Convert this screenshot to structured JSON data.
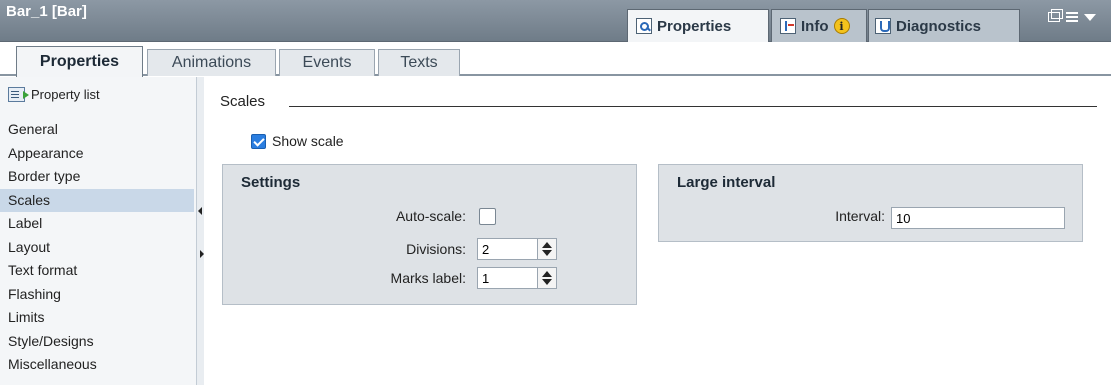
{
  "window": {
    "title": "Bar_1 [Bar]"
  },
  "inspector_tabs": [
    {
      "label": "Properties",
      "icon": "properties-icon",
      "active": true
    },
    {
      "label": "Info",
      "icon": "info-icon",
      "badge": "i"
    },
    {
      "label": "Diagnostics",
      "icon": "diagnostics-icon"
    }
  ],
  "sub_tabs": [
    {
      "label": "Properties",
      "active": true
    },
    {
      "label": "Animations"
    },
    {
      "label": "Events"
    },
    {
      "label": "Texts"
    }
  ],
  "sidebar": {
    "header": "Property list",
    "items": [
      {
        "label": "General"
      },
      {
        "label": "Appearance"
      },
      {
        "label": "Border type"
      },
      {
        "label": "Scales",
        "selected": true
      },
      {
        "label": "Label"
      },
      {
        "label": "Layout"
      },
      {
        "label": "Text format"
      },
      {
        "label": "Flashing"
      },
      {
        "label": "Limits"
      },
      {
        "label": "Style/Designs"
      },
      {
        "label": "Miscellaneous"
      }
    ]
  },
  "scales": {
    "section_title": "Scales",
    "show_scale": {
      "label": "Show scale",
      "checked": true
    },
    "settings": {
      "title": "Settings",
      "auto_scale": {
        "label": "Auto-scale:",
        "checked": false
      },
      "divisions": {
        "label": "Divisions:",
        "value": "2"
      },
      "marks_label": {
        "label": "Marks label:",
        "value": "1"
      }
    },
    "large_interval": {
      "title": "Large interval",
      "interval": {
        "label": "Interval:",
        "value": "10"
      }
    }
  },
  "colors": {
    "titlebar": "#7f8b97",
    "selected_item": "#c9d8e8",
    "group_bg": "#dee2e6",
    "checkbox_checked": "#2b7ee0"
  }
}
